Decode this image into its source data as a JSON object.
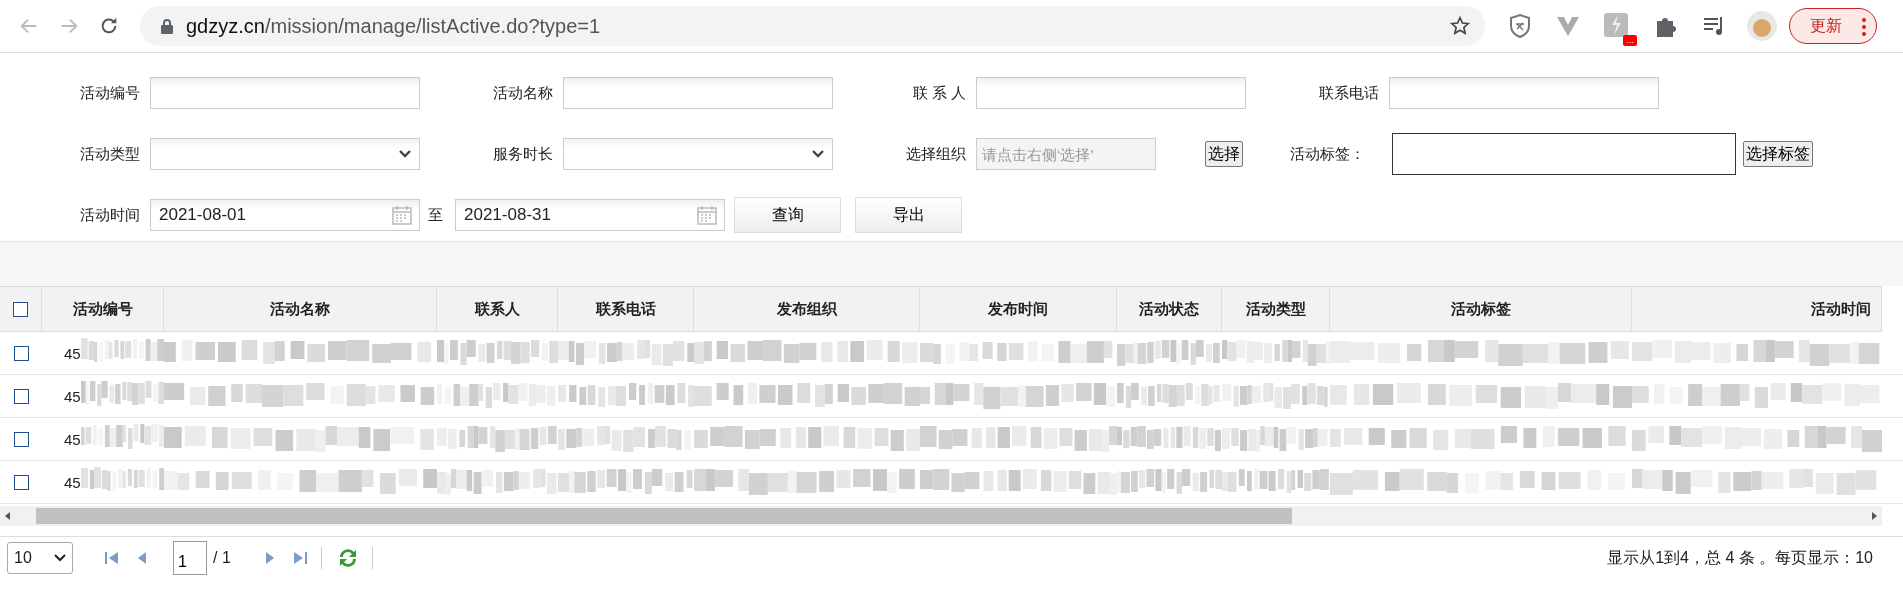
{
  "browser": {
    "url_host": "gdzyz.cn",
    "url_path": "/mission/manage/listActive.do?type=1",
    "extension_badge": "...",
    "update_button": "更新"
  },
  "filters": [
    [
      {
        "kind": "text",
        "label": "活动编号"
      },
      {
        "kind": "text",
        "label": "活动名称"
      },
      {
        "kind": "text",
        "label": "联 系 人"
      },
      {
        "kind": "text",
        "label": "联系电话"
      }
    ],
    [
      {
        "kind": "select",
        "label": "活动类型"
      },
      {
        "kind": "select",
        "label": "服务时长"
      },
      {
        "kind": "picker",
        "label": "选择组织",
        "placeholder": "请点击右侧‘选择’",
        "button": "选择"
      },
      {
        "kind": "tag",
        "label": "活动标签：",
        "button": "选择标签"
      }
    ],
    [
      {
        "kind": "date",
        "label": "活动时间",
        "value": "2021-08-01"
      },
      {
        "kind": "date",
        "label": "至",
        "value": "2021-08-31"
      },
      {
        "kind": "button",
        "label": "查询"
      },
      {
        "kind": "button",
        "label": "导出"
      }
    ]
  ],
  "table": {
    "select_all_checked": false,
    "columns": [
      "活动编号",
      "活动名称",
      "联系人",
      "联系电话",
      "发布组织",
      "发布时间",
      "活动状态",
      "活动类型",
      "活动标签",
      "活动时间"
    ],
    "rows": [
      {
        "checked": false,
        "number": "45"
      },
      {
        "checked": false,
        "number": "45"
      },
      {
        "checked": false,
        "number": "45"
      },
      {
        "checked": false,
        "number": "45"
      }
    ]
  },
  "pager": {
    "page_size": "10",
    "page": "1",
    "page_total": "/ 1",
    "summary": "显示从1到4，总 4 条 。每页显示：10"
  }
}
